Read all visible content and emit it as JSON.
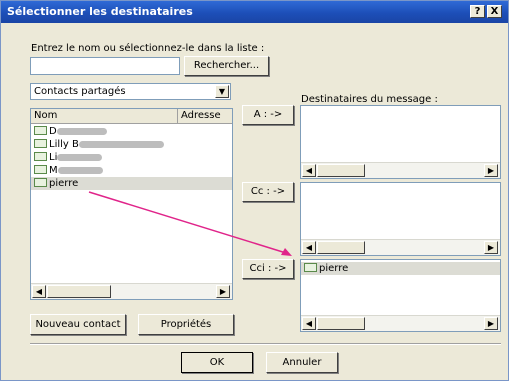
{
  "dialog": {
    "title": "Sélectionner les destinataires",
    "help_btn": "?",
    "close_btn": "X"
  },
  "search": {
    "prompt": "Entrez le nom ou sélectionnez-le dans la liste :",
    "value": "",
    "search_button": "Rechercher..."
  },
  "address_book": {
    "selected": "Contacts partagés"
  },
  "contacts": {
    "columns": [
      "Nom",
      "Adresse"
    ],
    "rows": [
      {
        "name": "D"
      },
      {
        "name": "Lilly B"
      },
      {
        "name": "Li"
      },
      {
        "name": "M"
      },
      {
        "name": "pierre"
      }
    ]
  },
  "recipients": {
    "label": "Destinataires du message :",
    "to_button": "A : ->",
    "cc_button": "Cc : ->",
    "bcc_button": "Cci : ->",
    "bcc_entries": [
      "pierre"
    ]
  },
  "bottom_buttons": {
    "new_contact": "Nouveau contact",
    "properties": "Propriétés",
    "ok": "OK",
    "cancel": "Annuler"
  },
  "colors": {
    "titlebar": "#1d4fb8",
    "dialog_bg": "#ece9d8",
    "arrow": "#e0248a"
  }
}
